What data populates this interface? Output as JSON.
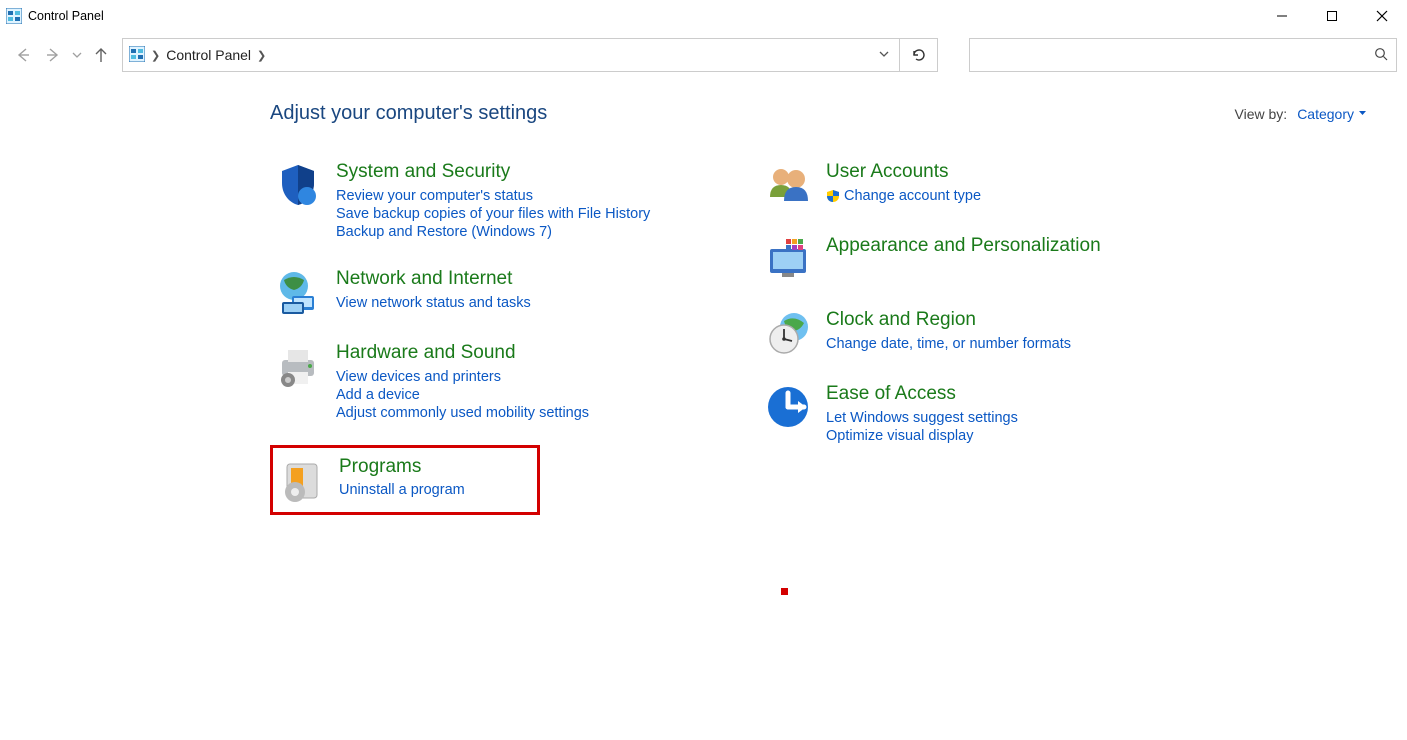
{
  "window": {
    "title": "Control Panel"
  },
  "breadcrumb": {
    "item1": "Control Panel"
  },
  "heading": "Adjust your computer's settings",
  "viewby": {
    "label": "View by:",
    "value": "Category"
  },
  "left": {
    "system": {
      "title": "System and Security",
      "links": [
        "Review your computer's status",
        "Save backup copies of your files with File History",
        "Backup and Restore (Windows 7)"
      ]
    },
    "network": {
      "title": "Network and Internet",
      "links": [
        "View network status and tasks"
      ]
    },
    "hardware": {
      "title": "Hardware and Sound",
      "links": [
        "View devices and printers",
        "Add a device",
        "Adjust commonly used mobility settings"
      ]
    },
    "programs": {
      "title": "Programs",
      "links": [
        "Uninstall a program"
      ]
    }
  },
  "right": {
    "users": {
      "title": "User Accounts",
      "links": [
        "Change account type"
      ]
    },
    "appearance": {
      "title": "Appearance and Personalization",
      "links": []
    },
    "clock": {
      "title": "Clock and Region",
      "links": [
        "Change date, time, or number formats"
      ]
    },
    "ease": {
      "title": "Ease of Access",
      "links": [
        "Let Windows suggest settings",
        "Optimize visual display"
      ]
    }
  }
}
